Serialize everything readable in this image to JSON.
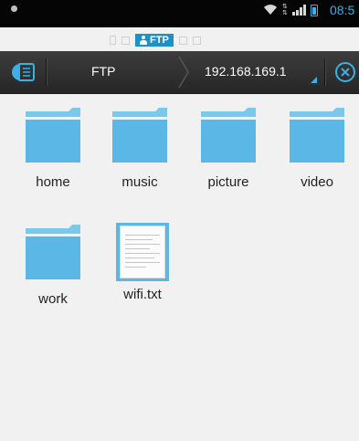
{
  "status_bar": {
    "time": "08:5",
    "icons": [
      "wifi-icon",
      "data-arrows-icon",
      "signal-icon",
      "battery-icon"
    ],
    "accent": "#3ab0e6"
  },
  "window_strip": {
    "active_label": "FTP"
  },
  "toolbar": {
    "breadcrumb": [
      "FTP",
      "192.168.169.1"
    ]
  },
  "files": [
    {
      "name": "home",
      "type": "folder"
    },
    {
      "name": "music",
      "type": "folder"
    },
    {
      "name": "picture",
      "type": "folder"
    },
    {
      "name": "video",
      "type": "folder"
    },
    {
      "name": "work",
      "type": "folder"
    },
    {
      "name": "wifi.txt",
      "type": "text-file"
    }
  ],
  "colors": {
    "folder": "#5bb7e6",
    "toolbar": "#2e2e2e",
    "background": "#f1f1f1"
  }
}
